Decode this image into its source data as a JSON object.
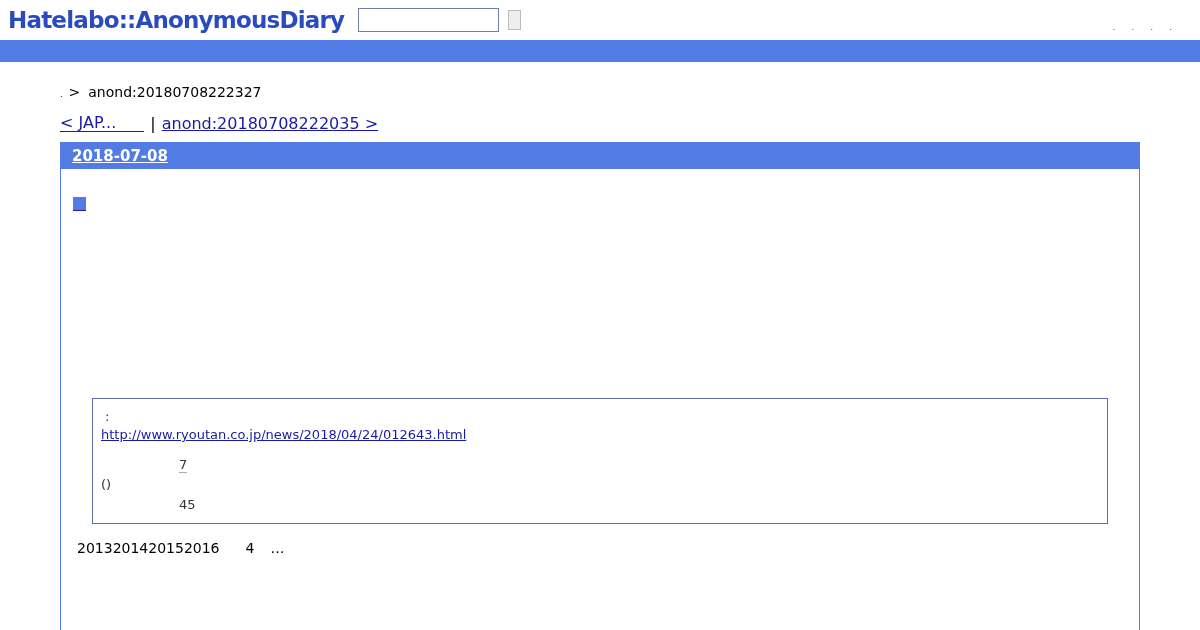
{
  "header": {
    "logo": "Hatelabo::AnonymousDiary",
    "search": {
      "kind": "text"
    },
    "menu_marks": [
      ".",
      ".",
      ".",
      "."
    ]
  },
  "breadcrumb": {
    "mark": ".",
    "separator": ">",
    "current": "anond:20180708222327"
  },
  "pager": {
    "prev": "< JAP...",
    "separator": "|",
    "next": "anond:20180708222035 >"
  },
  "day": {
    "date": "2018-07-08",
    "quote": {
      "label": ":",
      "link": "http://www.ryoutan.co.jp/news/2018/04/24/012643.html",
      "lines": [
        {
          "kind": "indent",
          "text": "7",
          "underlined": true
        },
        {
          "kind": "plain",
          "text": "()",
          "underlined": false
        },
        {
          "kind": "indent",
          "text": "45",
          "underlined": false
        }
      ]
    },
    "footer_texts": [
      "2013201420152016",
      "4",
      "…"
    ]
  }
}
